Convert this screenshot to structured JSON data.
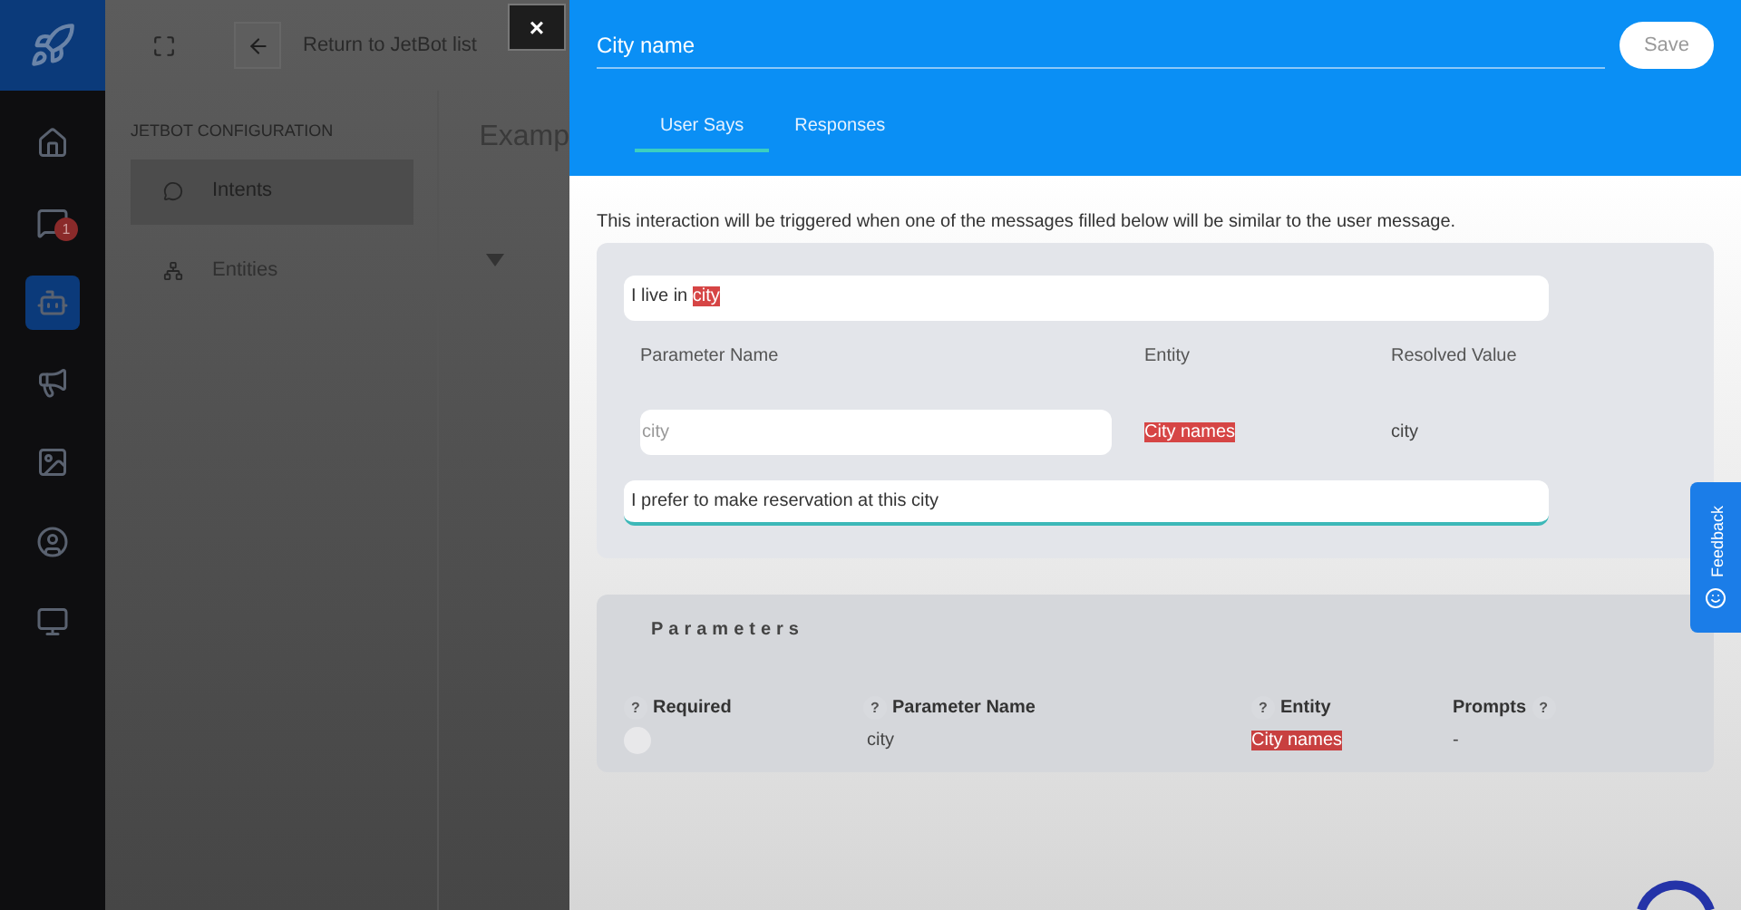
{
  "nav": {
    "items": [
      {
        "kind": "home",
        "selected": false
      },
      {
        "kind": "chat",
        "selected": false,
        "badge": "1"
      },
      {
        "kind": "robot",
        "selected": true
      },
      {
        "kind": "megaphone",
        "selected": false
      },
      {
        "kind": "gallery",
        "selected": false
      },
      {
        "kind": "user",
        "selected": false
      },
      {
        "kind": "monitor",
        "selected": false
      }
    ]
  },
  "background": {
    "back_link": "Return to JetBot list",
    "section_title": "JETBOT CONFIGURATION",
    "menu": [
      {
        "label": "Intents",
        "kind": "chat",
        "selected": true
      },
      {
        "label": "Entities",
        "kind": "tree",
        "selected": false
      }
    ],
    "content_title": "Examp"
  },
  "close_button": "×",
  "panel": {
    "title_field": {
      "value": "City name"
    },
    "save_button": "Save",
    "tabs": [
      {
        "label": "User Says",
        "selected": true
      },
      {
        "label": "Responses",
        "selected": false
      }
    ],
    "description": "This interaction will be triggered when one of the messages filled below will be similar to the user message.",
    "examples": [
      {
        "segments": [
          {
            "text": "I live in ",
            "highlight": false
          },
          {
            "text": "city",
            "highlight": true
          }
        ],
        "focused": false,
        "parameters": {
          "columns": [
            "Parameter Name",
            "Entity",
            "Resolved Value"
          ],
          "rows": [
            {
              "name": "city",
              "entity": "City names",
              "resolved": "city"
            }
          ]
        }
      },
      {
        "segments": [
          {
            "text": "I prefer to make reservation at this city",
            "highlight": false
          }
        ],
        "focused": true
      }
    ],
    "parameters": {
      "title": "Parameters",
      "columns": [
        {
          "label": "Required",
          "help": "?"
        },
        {
          "label": "Parameter Name",
          "help": "?"
        },
        {
          "label": "Entity",
          "help": "?"
        },
        {
          "label": "Prompts",
          "help": "?"
        }
      ],
      "rows": [
        {
          "required": false,
          "name": "city",
          "entity": "City names",
          "prompts": "-"
        }
      ]
    }
  },
  "feedback_tab": "Feedback"
}
